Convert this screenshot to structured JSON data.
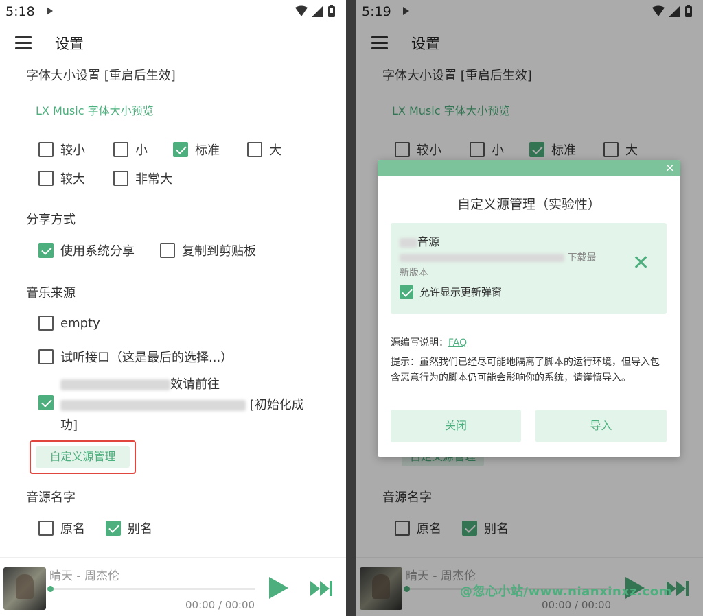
{
  "left": {
    "status": {
      "time": "5:18"
    },
    "appbar": {
      "title": "设置"
    },
    "font_section": {
      "title": "字体大小设置 [重启后生效]",
      "preview": "LX Music 字体大小预览",
      "options": [
        {
          "label": "较小",
          "checked": false
        },
        {
          "label": "小",
          "checked": false
        },
        {
          "label": "标准",
          "checked": true
        },
        {
          "label": "大",
          "checked": false
        },
        {
          "label": "较大",
          "checked": false
        },
        {
          "label": "非常大",
          "checked": false
        }
      ]
    },
    "share_section": {
      "title": "分享方式",
      "options": [
        {
          "label": "使用系统分享",
          "checked": true
        },
        {
          "label": "复制到剪贴板",
          "checked": false
        }
      ]
    },
    "source_section": {
      "title": "音乐来源",
      "options": [
        {
          "label": "empty",
          "checked": false
        },
        {
          "label": "试听接口（这是最后的选择...）",
          "checked": false
        },
        {
          "label_line1_suffix": "效请前往",
          "label_line2_suffix": "[初始化成",
          "label_line3": "功]",
          "checked": true
        }
      ],
      "custom_button": "自定义源管理"
    },
    "name_section": {
      "title": "音源名字",
      "options": [
        {
          "label": "原名",
          "checked": false
        },
        {
          "label": "别名",
          "checked": true
        }
      ]
    },
    "player": {
      "song": "晴天 - 周杰伦",
      "time": "00:00 / 00:00",
      "progress": 0
    }
  },
  "right": {
    "status": {
      "time": "5:19"
    },
    "appbar": {
      "title": "设置"
    },
    "font_section": {
      "title": "字体大小设置 [重启后生效]",
      "preview": "LX Music 字体大小预览",
      "options": [
        {
          "label": "较小",
          "checked": false
        },
        {
          "label": "小",
          "checked": false
        },
        {
          "label": "标准",
          "checked": true
        },
        {
          "label": "大",
          "checked": false
        }
      ]
    },
    "name_section": {
      "title": "音源名字",
      "options": [
        {
          "label": "原名",
          "checked": false
        },
        {
          "label": "别名",
          "checked": true
        }
      ]
    },
    "custom_button_partial": "自定义源管理",
    "player": {
      "song": "晴天 - 周杰伦",
      "time": "00:00 / 00:00",
      "progress": 0
    },
    "dialog": {
      "close": "×",
      "title": "自定义源管理（实验性）",
      "source": {
        "name_suffix": "音源",
        "desc_suffix": "下载最",
        "desc_line2": "新版本",
        "allow_popup_label": "允许显示更新弹窗",
        "allow_popup_checked": true
      },
      "note_label": "源编写说明：",
      "note_link": "FAQ",
      "tip": "提示：虽然我们已经尽可能地隔离了脚本的运行环境，但导入包含恶意行为的脚本仍可能会影响你的系统，请谨慎导入。",
      "close_button": "关闭",
      "import_button": "导入"
    }
  },
  "watermark": "@忽心小站/www.nianxinxz.com",
  "colors": {
    "accent": "#4caf7d",
    "accent_light": "#e3f4ea",
    "header": "#7cc39b",
    "highlight": "#e0463e"
  }
}
